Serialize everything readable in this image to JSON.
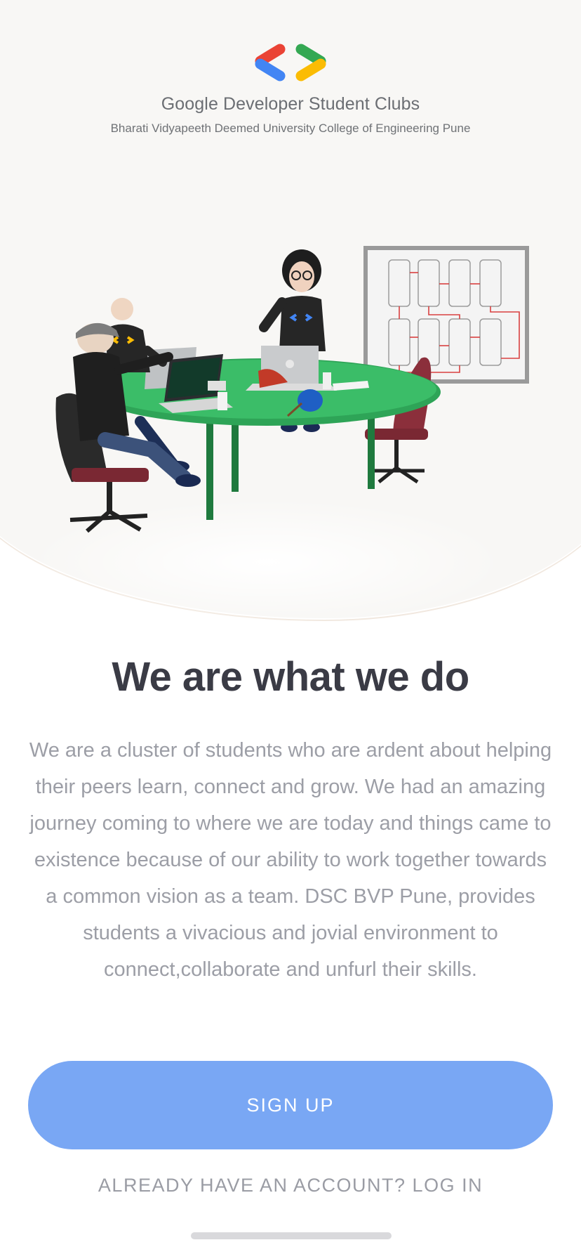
{
  "brand": {
    "logo_icon": "gdsc-brackets-logo",
    "title": "Google Developer Student Clubs",
    "subtitle": "Bharati Vidyapeeth Deemed University College of Engineering Pune",
    "colors": {
      "red": "#ea4335",
      "blue": "#4285f4",
      "green": "#34a853",
      "yellow": "#fbbc04"
    }
  },
  "hero": {
    "illustration_icon": "team-meeting-illustration"
  },
  "main": {
    "headline": "We are what we do",
    "description": "We are a cluster of students who are ardent about helping their peers learn, connect and grow. We had an amazing journey coming to where we are today and things came to existence because of our ability to work together towards a common vision as a team. DSC BVP Pune, provides students a vivacious and jovial environment to connect,collaborate and unfurl their skills."
  },
  "actions": {
    "signup_label": "SIGN UP",
    "signup_color": "#79a7f4",
    "login_label": "ALREADY HAVE AN ACCOUNT? LOG IN"
  }
}
